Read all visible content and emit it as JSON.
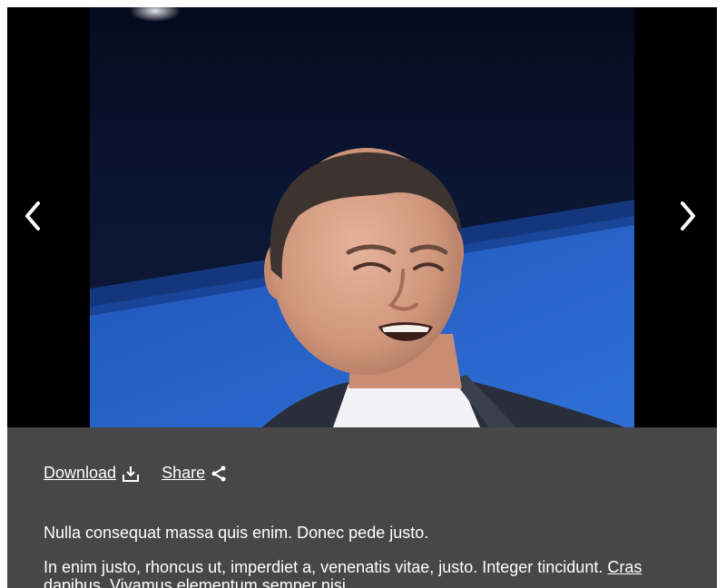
{
  "gallery": {
    "photo_alt": "",
    "prev_icon": "chevron-left-icon",
    "next_icon": "chevron-right-icon"
  },
  "actions": {
    "download_label": "Download",
    "download_icon": "download-icon",
    "share_label": "Share",
    "share_icon": "share-icon"
  },
  "caption": {
    "paragraph1": "Nulla consequat massa quis enim. Donec pede justo.",
    "paragraph2_text": "In enim justo, rhoncus ut, imperdiet a, venenatis vitae, justo. Integer tincidunt. ",
    "paragraph2_link": "Cras",
    "paragraph2_rest": "dapibus. Vivamus elementum semper nisi."
  },
  "colors": {
    "panel_bg": "#474747",
    "stage_bg": "#000000",
    "text": "#ffffff",
    "photo_backdrop": "#2b63c9"
  }
}
